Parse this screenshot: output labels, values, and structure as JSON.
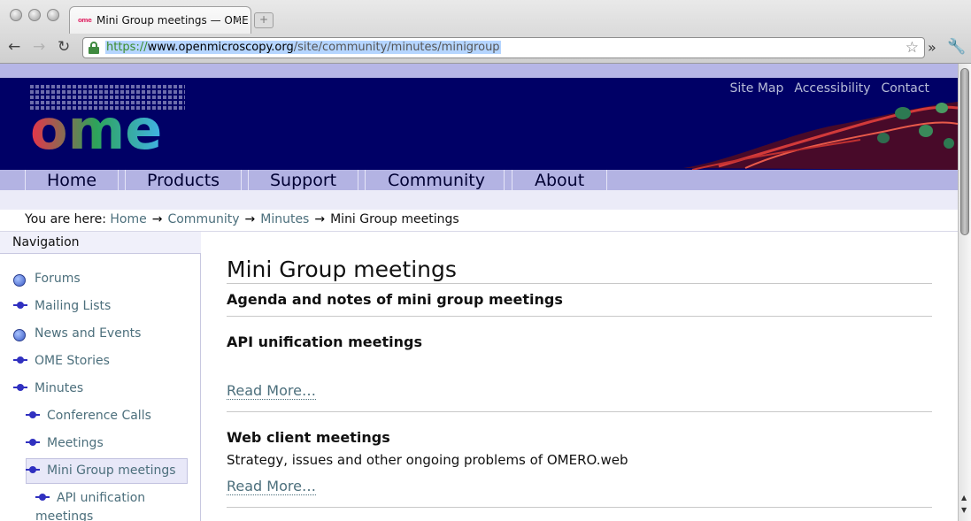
{
  "browser": {
    "tab_title": "Mini Group meetings — OME",
    "tab_favicon_text": "ome",
    "tab_close": "✕",
    "new_tab": "+",
    "back": "←",
    "forward": "→",
    "reload": "↻",
    "url_scheme": "https://",
    "url_domain": "www.openmicroscopy.org",
    "url_path": "/site/community/minutes/minigroup",
    "star": "☆",
    "overflow": "»",
    "wrench": "🔧"
  },
  "site": {
    "top_links": [
      "Site Map",
      "Accessibility",
      "Contact"
    ],
    "menu": [
      "Home",
      "Products",
      "Support",
      "Community",
      "About"
    ]
  },
  "breadcrumb": {
    "prefix": "You are here:",
    "items": [
      "Home",
      "Community",
      "Minutes",
      "Mini Group meetings"
    ],
    "arrow": "→"
  },
  "sidebar": {
    "heading": "Navigation",
    "items": [
      {
        "label": "Forums",
        "icon": "globe-icon"
      },
      {
        "label": "Mailing Lists",
        "icon": "bullet-icon"
      },
      {
        "label": "News and Events",
        "icon": "globe-icon"
      },
      {
        "label": "OME Stories",
        "icon": "bullet-icon"
      },
      {
        "label": "Minutes",
        "icon": "bullet-icon"
      },
      {
        "label": "Conference Calls",
        "icon": "bullet-icon"
      },
      {
        "label": "Meetings",
        "icon": "bullet-icon"
      },
      {
        "label": "Mini Group meetings",
        "icon": "bullet-icon",
        "selected": true
      },
      {
        "label": "API unification",
        "icon": "bullet-icon"
      },
      {
        "label": "meetings",
        "icon": ""
      }
    ]
  },
  "main": {
    "title": "Mini Group meetings",
    "subtitle": "Agenda and notes of mini group meetings",
    "items": [
      {
        "title": "API unification meetings",
        "description": "",
        "read_more": "Read More…"
      },
      {
        "title": "Web client meetings",
        "description": "Strategy, issues and other ongoing problems of OMERO.web",
        "read_more": "Read More…"
      }
    ]
  },
  "colors": {
    "banner": "#000066",
    "menubar": "#b3b3e3",
    "link": "#4c6f7c"
  }
}
